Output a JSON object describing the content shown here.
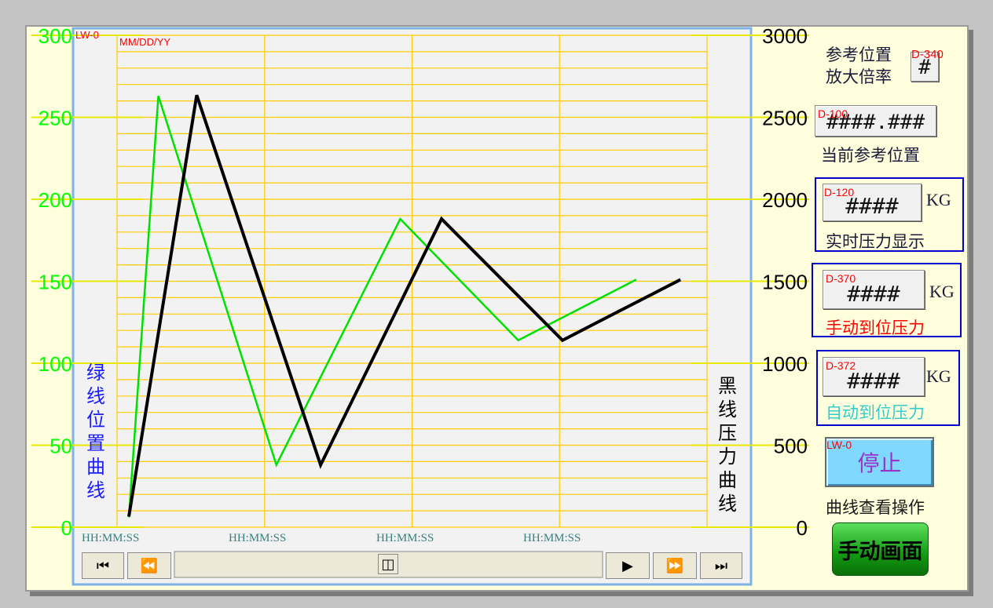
{
  "screen": {
    "chart_address": "LW-0",
    "date_format": "MM/DD/YY",
    "time_labels": [
      "HH:MM:SS",
      "HH:MM:SS",
      "HH:MM:SS",
      "HH:MM:SS"
    ],
    "left_axis_title": "绿线位置曲线",
    "right_axis_title": "黑线压力曲线"
  },
  "navigation": {
    "first": "⏮",
    "rewind": "⏪",
    "scroll_thumb": "◫",
    "play": "▶",
    "fast_forward": "⏩",
    "last": "⏭"
  },
  "right_panel": {
    "zoom": {
      "label_line1": "参考位置",
      "label_line2": "放大倍率",
      "address": "D-340",
      "value": "#"
    },
    "reference": {
      "address": "D-100",
      "value": "####.###",
      "label": "当前参考位置"
    },
    "realtime_pressure": {
      "address": "D-120",
      "value": "####",
      "unit": "KG",
      "label": "实时压力显示"
    },
    "manual_pressure": {
      "address": "D-370",
      "value": "####",
      "unit": "KG",
      "label": "手动到位压力"
    },
    "auto_pressure": {
      "address": "D-372",
      "value": "####",
      "unit": "KG",
      "label": "自动到位压力"
    },
    "stop_button": {
      "address": "LW-0",
      "label": "停止"
    },
    "curve_view_label": "曲线查看操作",
    "manual_screen_button": "手动画面"
  },
  "chart_data": {
    "type": "line",
    "grid": true,
    "y_left": {
      "min": 0,
      "max": 300,
      "ticks": [
        0,
        50,
        100,
        150,
        200,
        250,
        300
      ],
      "color": "#00ff00"
    },
    "y_right": {
      "min": 0,
      "max": 3000,
      "ticks": [
        0,
        500,
        1000,
        1500,
        2000,
        2500,
        3000
      ],
      "color": "#000000"
    },
    "x_range": [
      0,
      100
    ],
    "series": [
      {
        "axis": "left",
        "color": "#00e000",
        "x": [
          2,
          7,
          27,
          48,
          68,
          88
        ],
        "y": [
          6,
          263,
          38,
          188,
          114,
          151
        ]
      },
      {
        "axis": "right",
        "color": "#000000",
        "x": [
          2,
          13.5,
          34.5,
          55,
          75.5,
          95.5
        ],
        "y": [
          65,
          2635,
          380,
          1880,
          1140,
          1510
        ]
      }
    ]
  }
}
